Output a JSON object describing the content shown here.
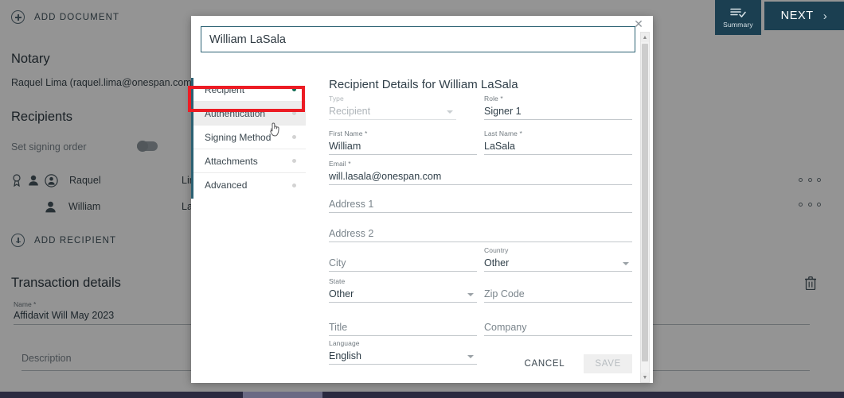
{
  "background": {
    "add_document_label": "ADD DOCUMENT",
    "notary_heading": "Notary",
    "notary_value": "Raquel Lima (raquel.lima@onespan.com)",
    "recipients_heading": "Recipients",
    "signing_order_label": "Set signing order",
    "recipients": [
      {
        "first": "Raquel",
        "last": "Lima"
      },
      {
        "first": "William",
        "last": "LaSala"
      }
    ],
    "add_recipient_label": "ADD RECIPIENT",
    "transaction_heading": "Transaction details",
    "name_label": "Name *",
    "name_value": "Affidavit Will May 2023",
    "description_placeholder": "Description"
  },
  "topbar": {
    "summary_label": "Summary",
    "next_label": "NEXT",
    "next_chevron": "›"
  },
  "modal": {
    "close_glyph": "✕",
    "title_input_value": "William LaSala",
    "detail_heading": "Recipient Details for William LaSala",
    "nav": [
      {
        "label": "Recipient",
        "status": "on"
      },
      {
        "label": "Authentication",
        "status": "off"
      },
      {
        "label": "Signing Method",
        "status": "off"
      },
      {
        "label": "Attachments",
        "status": "off"
      },
      {
        "label": "Advanced",
        "status": "off"
      }
    ],
    "fields": {
      "type": {
        "label": "Type",
        "value": "Recipient"
      },
      "role": {
        "label": "Role *",
        "value": "Signer 1"
      },
      "first_name": {
        "label": "First Name *",
        "value": "William"
      },
      "last_name": {
        "label": "Last Name *",
        "value": "LaSala"
      },
      "email": {
        "label": "Email *",
        "value": "will.lasala@onespan.com"
      },
      "address1": {
        "placeholder": "Address 1"
      },
      "address2": {
        "placeholder": "Address 2"
      },
      "city": {
        "placeholder": "City"
      },
      "country": {
        "label": "Country",
        "value": "Other"
      },
      "state": {
        "label": "State",
        "value": "Other"
      },
      "zip": {
        "placeholder": "Zip Code"
      },
      "title": {
        "placeholder": "Title"
      },
      "company": {
        "placeholder": "Company"
      },
      "language": {
        "label": "Language",
        "value": "English"
      }
    },
    "cancel_label": "CANCEL",
    "save_label": "SAVE"
  },
  "colors": {
    "accent_dark": "#1b3f51",
    "accent_teal": "#2b6173",
    "annotation_red": "#ec1c24",
    "status_green": "#0f6b52"
  }
}
